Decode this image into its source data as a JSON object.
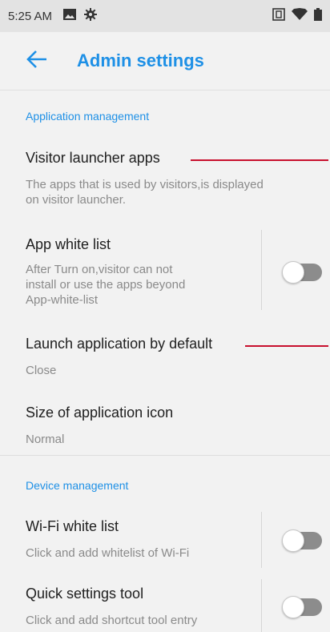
{
  "status_bar": {
    "time": "5:25 AM",
    "left_icons": [
      "image-icon",
      "gear-icon"
    ],
    "right_icons": [
      "nfc-icon",
      "wifi-icon",
      "battery-icon"
    ]
  },
  "app_bar": {
    "back_icon": "arrow-left-icon",
    "title": "Admin settings"
  },
  "sections": {
    "application": {
      "header": "Application management",
      "visitor_launcher": {
        "title": "Visitor launcher apps",
        "desc_line1": "The apps that is used by visitors,is displayed",
        "desc_line2": "on visitor launcher."
      },
      "app_white_list": {
        "title": "App white list",
        "desc_line1": "After Turn on,visitor can not",
        "desc_line2": "install or use the apps beyond",
        "desc_line3": "App-white-list",
        "toggle_on": false
      },
      "launch_default": {
        "title": "Launch application by default",
        "value": "Close"
      },
      "icon_size": {
        "title": "Size of application icon",
        "value": "Normal"
      }
    },
    "device": {
      "header": "Device management",
      "wifi_white_list": {
        "title": "Wi-Fi white list",
        "desc": "Click and add whitelist of Wi-Fi",
        "toggle_on": false
      },
      "quick_settings": {
        "title": "Quick settings tool",
        "desc": "Click and add shortcut tool entry",
        "toggle_on": false
      }
    }
  },
  "colors": {
    "accent": "#1e90e6",
    "annotation_line": "#c8102e",
    "toggle_off_track": "#8c8c8c"
  }
}
